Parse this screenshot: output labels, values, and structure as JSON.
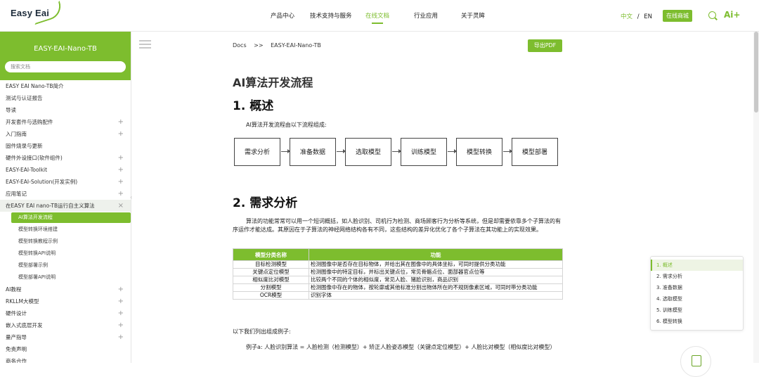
{
  "brand": {
    "logo": "Easy Eai",
    "accent": "#7dbd2e"
  },
  "nav": {
    "items": [
      "产品中心",
      "技术支持与服务",
      "在线文档",
      "行业应用",
      "关于灵眸"
    ],
    "active_index": 2,
    "lang_zh": "中文",
    "lang_sep": "/",
    "lang_en": "EN",
    "mall": "在线商城",
    "ai": "Ai+"
  },
  "sidebar": {
    "title": "EASY-EAI-Nano-TB",
    "search_placeholder": "搜索文档",
    "items": [
      {
        "label": "EASY EAI Nano-TB简介",
        "toggle": "",
        "level": 0
      },
      {
        "label": "测试与认证报告",
        "toggle": "",
        "level": 0
      },
      {
        "label": "导读",
        "toggle": "",
        "level": 0
      },
      {
        "label": "开发套件与选购配件",
        "toggle": "+",
        "level": 0
      },
      {
        "label": "入门指南",
        "toggle": "+",
        "level": 0
      },
      {
        "label": "固件烧录与更新",
        "toggle": "",
        "level": 0
      },
      {
        "label": "硬件外设接口(软件组件)",
        "toggle": "+",
        "level": 0
      },
      {
        "label": "EASY-EAI-Toolkit",
        "toggle": "+",
        "level": 0
      },
      {
        "label": "EASY-EAI-Solution(开发实例)",
        "toggle": "+",
        "level": 0
      },
      {
        "label": "应用笔记",
        "toggle": "+",
        "level": 0
      },
      {
        "label": "在EASY EAI nano-TB运行自主义算法",
        "toggle": "×",
        "level": 0,
        "state": "open"
      },
      {
        "label": "AI算法开发流程",
        "toggle": "",
        "level": 1,
        "state": "active"
      },
      {
        "label": "模型转换环境搭建",
        "toggle": "",
        "level": 1
      },
      {
        "label": "模型转换教程示例",
        "toggle": "",
        "level": 1
      },
      {
        "label": "模型转换API说明",
        "toggle": "",
        "level": 1
      },
      {
        "label": "模型部署示例",
        "toggle": "",
        "level": 1
      },
      {
        "label": "模型部署API说明",
        "toggle": "",
        "level": 1
      },
      {
        "label": "AI教程",
        "toggle": "+",
        "level": 0
      },
      {
        "label": "RKLLM大模型",
        "toggle": "+",
        "level": 0
      },
      {
        "label": "硬件设计",
        "toggle": "+",
        "level": 0
      },
      {
        "label": "嵌入式底层开发",
        "toggle": "+",
        "level": 0
      },
      {
        "label": "量产指导",
        "toggle": "+",
        "level": 0
      },
      {
        "label": "免责声明",
        "toggle": "",
        "level": 0
      },
      {
        "label": "商务合作",
        "toggle": "",
        "level": 0
      }
    ]
  },
  "content": {
    "breadcrumb": {
      "root": "Docs",
      "sep": ">>",
      "current": "EASY-EAI-Nano-TB"
    },
    "pdf_button": "导出PDF",
    "page_title": "AI算法开发流程",
    "section1_title": "1. 概述",
    "section1_intro": "AI算法开发流程由以下流程组成:",
    "flow_steps": [
      "需求分析",
      "准备数据",
      "选取模型",
      "训练模型",
      "模型转换",
      "模型部署"
    ],
    "section2_title": "2. 需求分析",
    "section2_para": "算法的功能常常可以用一个短词概括，如人脸识别、司机行为检测、商场顾客行为分析等系统，但是却需要依靠多个子算法的有序运作才能达成。其原因在于子算法的神经网络结构各有不同，这些结构的差异化优化了各个子算法在其功能上的实现效果。",
    "table": {
      "headers": [
        "模型分类名称",
        "功能"
      ],
      "rows": [
        [
          "目标检测模型",
          "检测图像中是否存在目标物体，并给出其在图像中的具体坐标，可同时提供分类功能"
        ],
        [
          "关键点定位模型",
          "检测图像中的特定目标，并标出关键点位，常见骨骼点位、面部器官点位等"
        ],
        [
          "相似度比对模型",
          "比较两个不同的个体的相似度，常见人脸、猪脸识别，商品识别"
        ],
        [
          "分割模型",
          "检测图像中存在的物体，按轮廓或其他标准分割出物体所在的不规则像素区域，可同时带分类功能"
        ],
        [
          "OCR模型",
          "识别字体"
        ]
      ]
    },
    "examples_intro": "以下我们列出组成例子:",
    "example_a": "例子a: 人脸识别算法 = 人脸检测（检测模型）+ 矫正人脸姿态模型（关键点定位模型）+ 人脸比对模型（相似度比对模型）"
  },
  "toc": {
    "items": [
      "1. 概述",
      "2. 需求分析",
      "3. 准备数据",
      "4. 选取模型",
      "5. 训练模型",
      "6. 模型转换"
    ],
    "active_index": 0
  }
}
